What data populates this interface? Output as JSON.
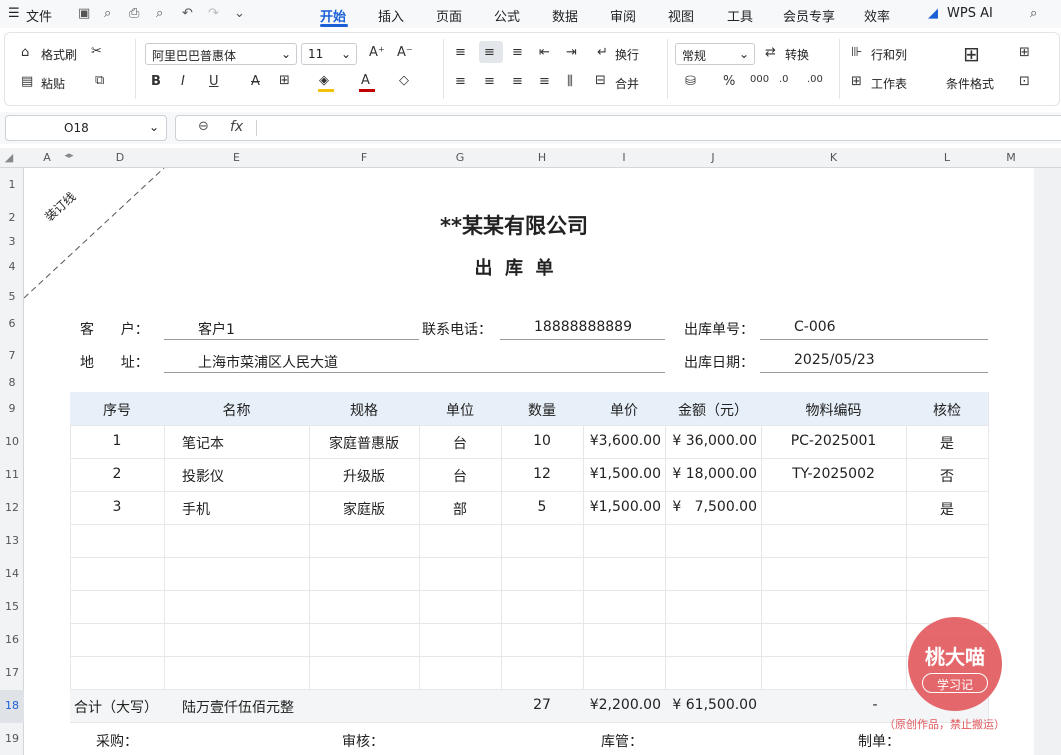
{
  "menu": {
    "hamburger": "☰",
    "file": "文件",
    "tabs": [
      "开始",
      "插入",
      "页面",
      "公式",
      "数据",
      "审阅",
      "视图",
      "工具",
      "会员专享",
      "效率"
    ],
    "ai": "WPS AI"
  },
  "ribbon": {
    "format_painter": "格式刷",
    "paste": "粘贴",
    "font_name": "阿里巴巴普惠体",
    "font_size": "11",
    "wrap": "换行",
    "merge": "合并",
    "number_format": "常规",
    "convert": "转换",
    "row_col": "行和列",
    "worksheet": "工作表",
    "cond_format": "条件格式"
  },
  "namebox": "O18",
  "fx": "fx",
  "columns": [
    "A",
    "D",
    "E",
    "F",
    "G",
    "H",
    "I",
    "J",
    "K",
    "L",
    "M"
  ],
  "rows": [
    "1",
    "2",
    "3",
    "4",
    "5",
    "6",
    "7",
    "8",
    "9",
    "10",
    "11",
    "12",
    "13",
    "14",
    "15",
    "16",
    "17",
    "18",
    "19"
  ],
  "doc": {
    "binding": "装订线",
    "company": "**某某有限公司",
    "title": "出  库  单",
    "customer_label": "客      户：",
    "customer": "客户1",
    "phone_label": "联系电话：",
    "phone": "18888888889",
    "order_no_label": "出库单号：",
    "order_no": "C-006",
    "address_label": "地      址：",
    "address": "上海市菜浦区人民大道",
    "date_label": "出库日期：",
    "date": "2025/05/23",
    "headers": [
      "序号",
      "名称",
      "规格",
      "单位",
      "数量",
      "单价",
      "金额（元）",
      "物料编码",
      "核检"
    ],
    "items": [
      [
        "1",
        "笔记本",
        "家庭普惠版",
        "台",
        "10",
        "¥3,600.00",
        "¥ 36,000.00",
        "PC-2025001",
        "是"
      ],
      [
        "2",
        "投影仪",
        "升级版",
        "台",
        "12",
        "¥1,500.00",
        "¥ 18,000.00",
        "TY-2025002",
        "否"
      ],
      [
        "3",
        "手机",
        "家庭版",
        "部",
        "5",
        "¥1,500.00",
        "¥   7,500.00",
        "",
        "是"
      ]
    ],
    "total_label": "合计（大写）",
    "total_words": "陆万壹仟伍佰元整",
    "total_qty": "27",
    "total_price": "¥2,200.00",
    "total_amount": "¥ 61,500.00",
    "total_code": "-",
    "footer": {
      "purchase": "采购：",
      "review": "审核：",
      "warehouse": "库管：",
      "maker": "制单："
    }
  },
  "watermark": {
    "line1": "桃大喵",
    "line2": "学习记",
    "note": "（原创作品，禁止搬运）"
  }
}
